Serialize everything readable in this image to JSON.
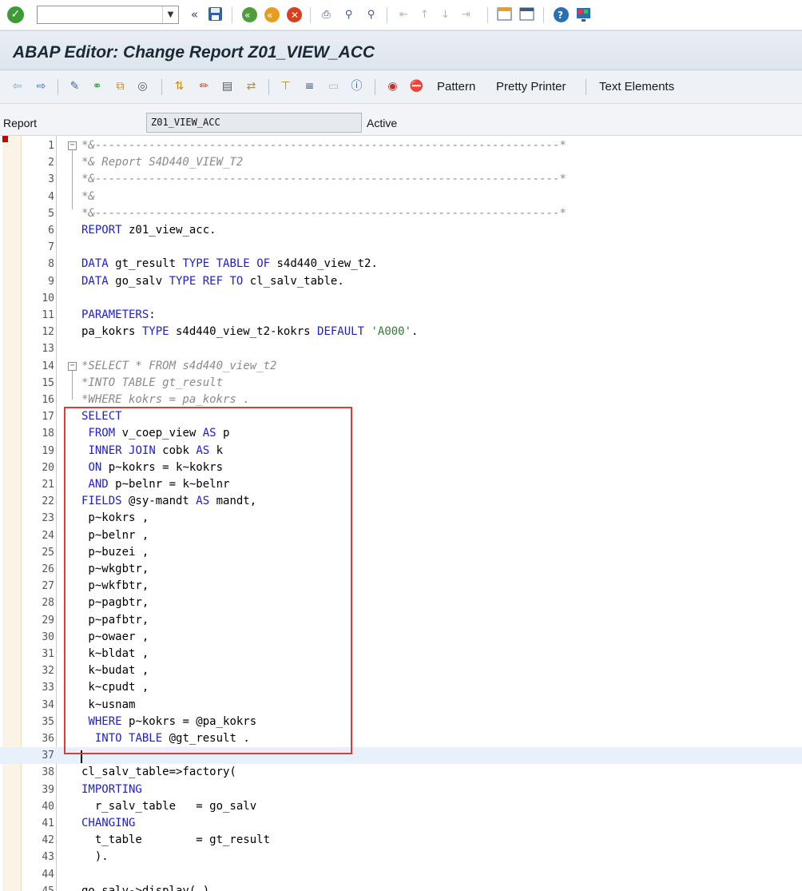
{
  "toolbar": {
    "command_field_value": "",
    "icons": [
      "check-icon",
      "command-field",
      "collapse-icon",
      "save-icon",
      "back-icon",
      "exit-icon",
      "cancel-icon",
      "print-icon",
      "find-icon",
      "find-next-icon",
      "first-page-icon",
      "previous-page-icon",
      "next-page-icon",
      "last-page-icon",
      "new-session-icon",
      "shortcut-icon",
      "help-icon",
      "customize-icon"
    ]
  },
  "title": "ABAP Editor: Change Report Z01_VIEW_ACC",
  "app_toolbar": {
    "pattern_label": "Pattern",
    "pretty_printer_label": "Pretty Printer",
    "text_elements_label": "Text Elements"
  },
  "report": {
    "label": "Report",
    "value": "Z01_VIEW_ACC",
    "status": "Active"
  },
  "editor": {
    "cursor_line": 37,
    "lines": [
      {
        "n": "1",
        "text": "*&---------------------------------------------------------------------*",
        "comment": true,
        "fold": "start"
      },
      {
        "n": "2",
        "text": "*& Report S4D440_VIEW_T2",
        "comment": true
      },
      {
        "n": "3",
        "text": "*&---------------------------------------------------------------------*",
        "comment": true
      },
      {
        "n": "4",
        "text": "*&",
        "comment": true
      },
      {
        "n": "5",
        "text": "*&---------------------------------------------------------------------*",
        "comment": true,
        "fold": "end"
      },
      {
        "n": "6",
        "text": "REPORT z01_view_acc."
      },
      {
        "n": "7",
        "text": ""
      },
      {
        "n": "8",
        "text": "DATA gt_result TYPE TABLE OF s4d440_view_t2."
      },
      {
        "n": "9",
        "text": "DATA go_salv TYPE REF TO cl_salv_table."
      },
      {
        "n": "10",
        "text": ""
      },
      {
        "n": "11",
        "text": "PARAMETERS:"
      },
      {
        "n": "12",
        "text": "pa_kokrs TYPE s4d440_view_t2-kokrs DEFAULT 'A000'."
      },
      {
        "n": "13",
        "text": ""
      },
      {
        "n": "14",
        "text": "*SELECT * FROM s4d440_view_t2",
        "comment": true,
        "fold": "start"
      },
      {
        "n": "15",
        "text": "*INTO TABLE gt_result",
        "comment": true
      },
      {
        "n": "16",
        "text": "*WHERE kokrs = pa_kokrs .",
        "comment": true,
        "fold": "end"
      },
      {
        "n": "17",
        "text": "SELECT"
      },
      {
        "n": "18",
        "text": " FROM v_coep_view AS p"
      },
      {
        "n": "19",
        "text": " INNER JOIN cobk AS k"
      },
      {
        "n": "20",
        "text": " ON p~kokrs = k~kokrs"
      },
      {
        "n": "21",
        "text": " AND p~belnr = k~belnr"
      },
      {
        "n": "22",
        "text": "FIELDS @sy-mandt AS mandt,"
      },
      {
        "n": "23",
        "text": " p~kokrs ,"
      },
      {
        "n": "24",
        "text": " p~belnr ,"
      },
      {
        "n": "25",
        "text": " p~buzei ,"
      },
      {
        "n": "26",
        "text": " p~wkgbtr,"
      },
      {
        "n": "27",
        "text": " p~wkfbtr,"
      },
      {
        "n": "28",
        "text": " p~pagbtr,"
      },
      {
        "n": "29",
        "text": " p~pafbtr,"
      },
      {
        "n": "30",
        "text": " p~owaer ,"
      },
      {
        "n": "31",
        "text": " k~bldat ,"
      },
      {
        "n": "32",
        "text": " k~budat ,"
      },
      {
        "n": "33",
        "text": " k~cpudt ,"
      },
      {
        "n": "34",
        "text": " k~usnam"
      },
      {
        "n": "35",
        "text": " WHERE p~kokrs = @pa_kokrs"
      },
      {
        "n": "36",
        "text": "  INTO TABLE @gt_result ."
      },
      {
        "n": "37",
        "text": ""
      },
      {
        "n": "38",
        "text": "cl_salv_table=>factory("
      },
      {
        "n": "39",
        "text": "IMPORTING"
      },
      {
        "n": "40",
        "text": "  r_salv_table   = go_salv"
      },
      {
        "n": "41",
        "text": "CHANGING"
      },
      {
        "n": "42",
        "text": "  t_table        = gt_result"
      },
      {
        "n": "43",
        "text": "  )."
      },
      {
        "n": "44",
        "text": ""
      },
      {
        "n": "45",
        "text": "go_salv->display( )."
      }
    ]
  },
  "colors": {
    "keyword": "#1e1ecc",
    "comment": "#8a8a8a",
    "string": "#2e7d32",
    "highlight_border": "#e03b3b"
  }
}
